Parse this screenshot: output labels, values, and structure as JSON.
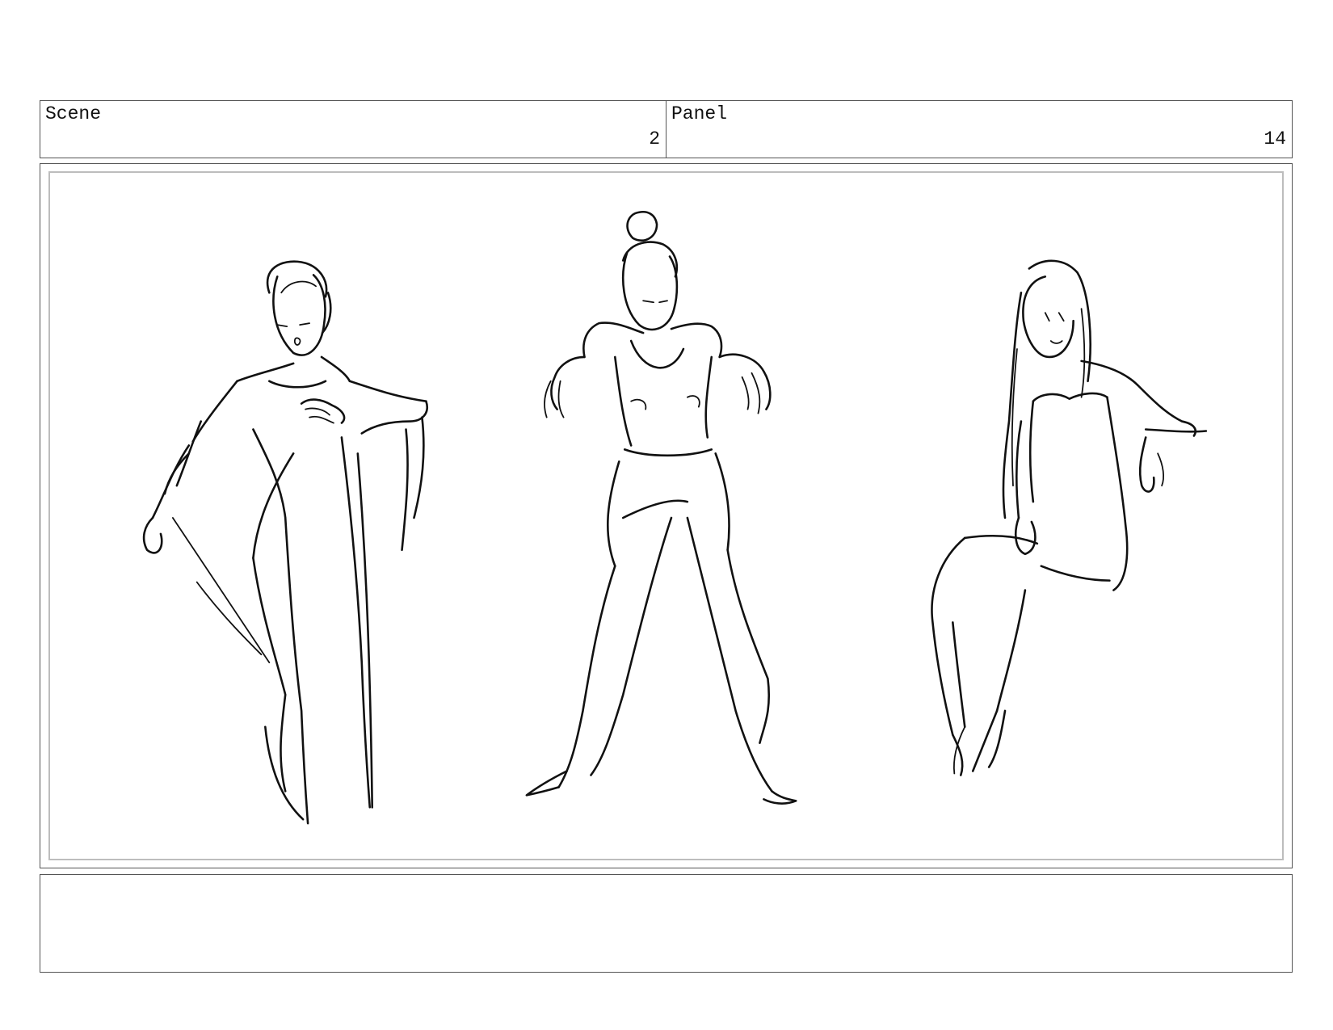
{
  "header": {
    "scene_label": "Scene",
    "scene_number": "2",
    "panel_label": "Panel",
    "panel_number": "14"
  },
  "panel": {
    "figures": [
      "woman-in-gown-sketch",
      "woman-with-hair-bun-sketch",
      "seated-woman-sketch"
    ]
  },
  "notes": {
    "text": ""
  }
}
